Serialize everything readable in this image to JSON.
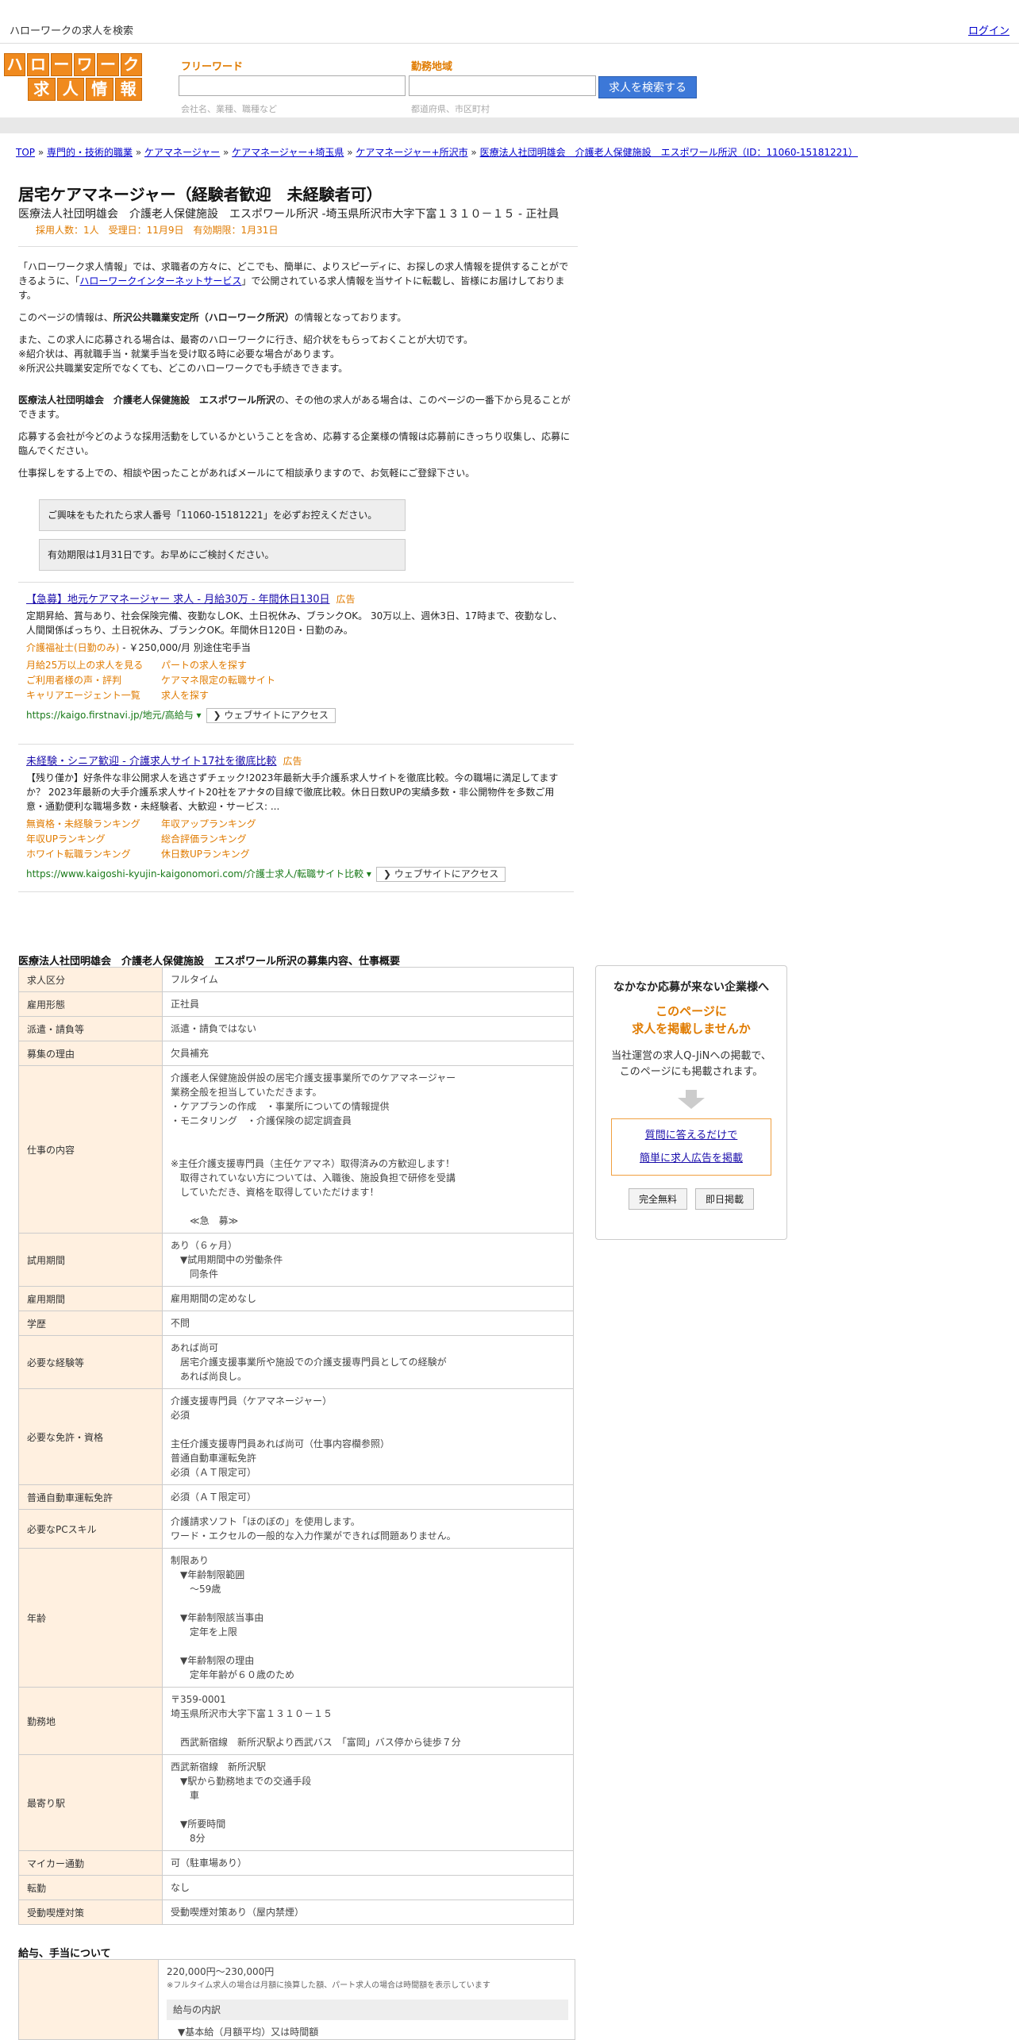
{
  "topbar": {
    "site": "ハローワークの求人を検索",
    "login": "ログイン"
  },
  "logo": {
    "row1": [
      "ハ",
      "ロ",
      "ー",
      "ワ",
      "ー",
      "ク"
    ],
    "row2": [
      "求",
      "人",
      "情",
      "報"
    ]
  },
  "search": {
    "free_label": "フリーワード",
    "free_hint": "会社名、業種、職種など",
    "area_label": "勤務地域",
    "area_hint": "都道府県、市区町村",
    "button": "求人を検索する"
  },
  "breadcrumb": [
    "TOP",
    "専門的・技術的職業",
    "ケアマネージャー",
    "ケアマネージャー+埼玉県",
    "ケアマネージャー+所沢市",
    "医療法人社団明雄会　介護老人保健施設　エスポワール所沢（ID：11060-15181221）"
  ],
  "job": {
    "title": "居宅ケアマネージャー（経験者歓迎　未経験者可）",
    "subtitle": "医療法人社団明雄会　介護老人保健施設　エスポワール所沢 -埼玉県所沢市大字下富１３１０－１５ - 正社員",
    "meta": "採用人数：1人　受理日：11月9日　有効期限：1月31日"
  },
  "intro": {
    "p1a": "「ハローワーク求人情報」では、求職者の方々に、どこでも、簡単に、よりスピーディに、お探しの求人情報を提供することができるように、「",
    "p1link": "ハローワークインターネットサービス",
    "p1b": "」で公開されている求人情報を当サイトに転載し、皆様にお届けしております。",
    "p2a": "このページの情報は、",
    "p2b": "所沢公共職業安定所（ハローワーク所沢）",
    "p2c": "の情報となっております。",
    "p3": "また、この求人に応募される場合は、最寄のハローワークに行き、紹介状をもらっておくことが大切です。",
    "p4": "※紹介状は、再就職手当・就業手当を受け取る時に必要な場合があります。",
    "p5": "※所沢公共職業安定所でなくても、どこのハローワークでも手続きできます。",
    "p6a": "医療法人社団明雄会　介護老人保健施設　エスポワール所沢",
    "p6b": "の、その他の求人がある場合は、このページの一番下から見ることができます。",
    "p7": "応募する会社が今どのような採用活動をしているかということを含め、応募する企業様の情報は応募前にきっちり収集し、応募に臨んでください。",
    "p8": "仕事探しをする上での、相談や困ったことがあればメールにて相談承りますので、お気軽にご登録下さい。",
    "notice1": "ご興味をもたれたら求人番号「11060-15181221」を必ずお控えください。",
    "notice2": "有効期限は1月31日です。お早めにご検討ください。"
  },
  "ads": [
    {
      "headline": "【急募】地元ケアマネージャー 求人 - 月給30万 - 年間休日130日",
      "tag": "広告",
      "desc": "定期昇給、賞与あり、社会保険完備、夜勤なしOK、土日祝休み、ブランクOK。 30万以上、週休3日、17時まで、夜勤なし、人間関係ばっちり、土日祝休み、ブランクOK。年間休日120日・日勤のみ。",
      "sub_a": "介護福祉士(日勤のみ)",
      "sub_b": " - ￥250,000/月 別途住宅手当",
      "links": [
        "月給25万以上の求人を見る",
        "パートの求人を探す",
        "ご利用者様の声・評判",
        "ケアマネ限定の転職サイト",
        "キャリアエージェント一覧",
        "求人を探す"
      ],
      "url": "https://kaigo.firstnavi.jp/地元/高給与",
      "visit": "❯ ウェブサイトにアクセス"
    },
    {
      "headline": "未経験・シニア歓迎 - 介護求人サイト17社を徹底比較",
      "tag": "広告",
      "desc": "【残り僅か】好条件な非公開求人を逃さずチェック!2023年最新大手介護系求人サイトを徹底比較。今の職場に満足してますか？ 2023年最新の大手介護系求人サイト20社をアナタの目線で徹底比較。休日日数UPの実績多数・非公開物件を多数ご用意・通勤便利な職場多数・未経験者、大歓迎・サービス: ...",
      "sub_a": "",
      "sub_b": "",
      "links": [
        "無資格・未経験ランキング",
        "年収アップランキング",
        "年収UPランキング",
        "総合評価ランキング",
        "ホワイト転職ランキング",
        "休日数UPランキング"
      ],
      "url": "https://www.kaigoshi-kyujin-kaigonomori.com/介護士求人/転職サイト比較",
      "visit": "❯ ウェブサイトにアクセス"
    }
  ],
  "details_title": "医療法人社団明雄会　介護老人保健施設　エスポワール所沢の募集内容、仕事概要",
  "details": [
    {
      "k": "求人区分",
      "v": "フルタイム"
    },
    {
      "k": "雇用形態",
      "v": "正社員"
    },
    {
      "k": "派遣・請負等",
      "v": "派遣・請負ではない"
    },
    {
      "k": "募集の理由",
      "v": "欠員補充"
    },
    {
      "k": "仕事の内容",
      "v": "介護老人保健施設併設の居宅介護支援事業所でのケアマネージャー\n業務全般を担当していただきます。\n・ケアプランの作成　・事業所についての情報提供\n・モニタリング　・介護保険の認定調査員\n\n\n※主任介護支援専門員（主任ケアマネ）取得済みの方歓迎します！\n　取得されていない方については、入職後、施設負担で研修を受講\n　していただき、資格を取得していただけます！\n\n　　≪急　募≫"
    },
    {
      "k": "試用期間",
      "v": "あり（６ヶ月）\n　▼試用期間中の労働条件\n　　同条件"
    },
    {
      "k": "雇用期間",
      "v": "雇用期間の定めなし"
    },
    {
      "k": "学歴",
      "v": "不問"
    },
    {
      "k": "必要な経験等",
      "v": "あれば尚可\n　居宅介護支援事業所や施設での介護支援専門員としての経験が\n　あれば尚良し。"
    },
    {
      "k": "必要な免許・資格",
      "v": "介護支援専門員（ケアマネージャー）\n必須\n\n主任介護支援専門員あれば尚可（仕事内容欄参照）\n普通自動車運転免許\n必須（ＡＴ限定可）"
    },
    {
      "k": "普通自動車運転免許",
      "v": "必須（ＡＴ限定可）"
    },
    {
      "k": "必要なPCスキル",
      "v": "介護請求ソフト「ほのぼの」を使用します。\nワード・エクセルの一般的な入力作業ができれば問題ありません。"
    },
    {
      "k": "年齢",
      "v": "制限あり\n　▼年齢制限範囲\n　　〜59歳\n\n　▼年齢制限該当事由\n　　定年を上限\n\n　▼年齢制限の理由\n　　定年年齢が６０歳のため"
    },
    {
      "k": "勤務地",
      "v": "〒359-0001\n埼玉県所沢市大字下富１３１０－１５\n\n　西武新宿線　新所沢駅より西武バス　「富岡」バス停から徒歩７分"
    },
    {
      "k": "最寄り駅",
      "v": "西武新宿線　新所沢駅\n　▼駅から勤務地までの交通手段\n　　車\n\n　▼所要時間\n　　8分"
    },
    {
      "k": "マイカー通勤",
      "v": "可（駐車場あり）"
    },
    {
      "k": "転勤",
      "v": "なし"
    },
    {
      "k": "受動喫煙対策",
      "v": "受動喫煙対策あり（屋内禁煙）"
    }
  ],
  "salary": {
    "title": "給与、手当について",
    "range": "220,000円〜230,000円",
    "note": "※フルタイム求人の場合は月額に換算した額、パート求人の場合は時間額を表示しています",
    "breakdown": "給与の内訳",
    "item": "▼基本給（月額平均）又は時間額"
  },
  "side": {
    "t1": "なかなか応募が来ない企業様へ",
    "t2a": "このページに",
    "t2b": "求人を掲載しませんか",
    "t3a": "当社運営の求人Q-JiNへの掲載で、",
    "t3b": "このページにも掲載されます。",
    "link1": "質問に答えるだけで",
    "link2": "簡単に求人広告を掲載",
    "btn1": "完全無料",
    "btn2": "即日掲載"
  }
}
